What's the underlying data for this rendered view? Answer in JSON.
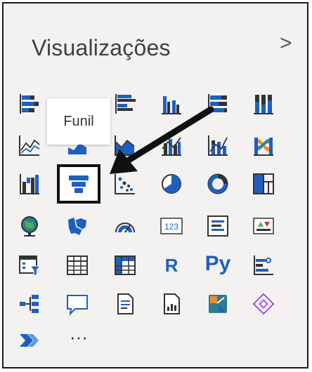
{
  "panel": {
    "title": "Visualizações",
    "expand_glyph": ">"
  },
  "tooltip": {
    "text": "Funil"
  },
  "icons": {
    "row1": [
      "stacked-bar-icon",
      "stacked-column-icon",
      "clustered-bar-icon",
      "clustered-column-icon",
      "100-stacked-bar-icon",
      "100-stacked-column-icon"
    ],
    "row2": [
      "line-chart-icon",
      "area-chart-icon",
      "stacked-area-icon",
      "line-clustered-column-icon",
      "line-stacked-column-icon",
      "ribbon-chart-icon"
    ],
    "row3": [
      "waterfall-icon",
      "funnel-icon",
      "scatter-icon",
      "pie-icon",
      "donut-icon",
      "treemap-icon"
    ],
    "row4": [
      "map-icon",
      "filled-map-icon",
      "gauge-icon",
      "card-icon",
      "multi-row-card-icon",
      "kpi-icon"
    ],
    "row5": [
      "slicer-icon",
      "table-icon",
      "matrix-icon",
      "r-visual-icon",
      "python-visual-icon",
      "key-influencers-icon"
    ],
    "row6": [
      "decomposition-tree-icon",
      "qa-icon",
      "smart-narrative-icon",
      "paginated-report-icon",
      "power-automate-icon",
      "power-apps-icon"
    ],
    "row7": [
      "power-automate-chevron-icon",
      "more-options-icon"
    ]
  },
  "labels": {
    "card_value": "123",
    "r_label": "R",
    "py_label": "Py",
    "more_label": "···"
  },
  "colors": {
    "blue": "#1f5fbf",
    "dark": "#2b2b2b",
    "teal": "#2e7d8c",
    "orange": "#e8912d",
    "purple": "#9b4fc7"
  }
}
